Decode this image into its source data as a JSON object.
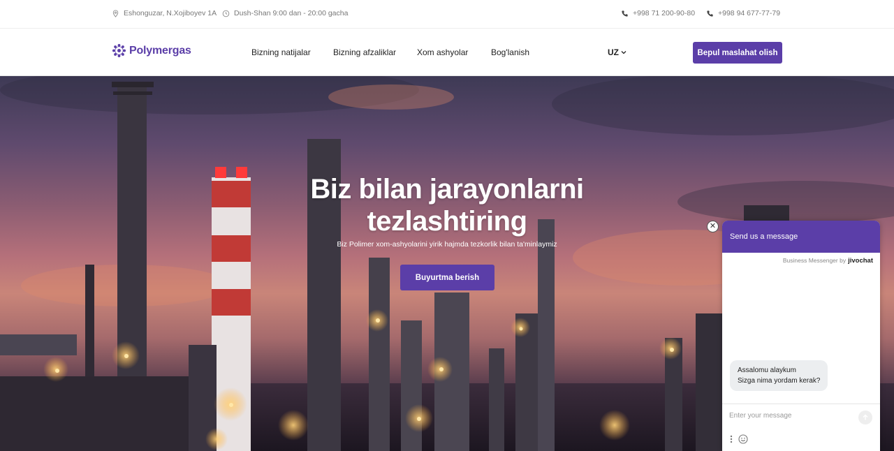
{
  "topbar": {
    "address": "Eshonguzar, N.Xojiboyev 1A",
    "hours": "Dush-Shan 9:00 dan - 20:00 gacha",
    "phone1": "+998 71 200-90-80",
    "phone2": "+998 94 677-77-79"
  },
  "nav": {
    "logo": "Polymergas",
    "links": [
      "Bizning natijalar",
      "Bizning afzaliklar",
      "Xom ashyolar",
      "Bog'lanish"
    ],
    "language": "UZ",
    "cta": "Bepul maslahat olish"
  },
  "hero": {
    "title_line1": "Biz bilan jarayonlarni",
    "title_line2": "tezlashtiring",
    "subtitle": "Biz Polimer xom-ashyolarini yirik hajmda tezkorlik bilan ta'minlaymiz",
    "button": "Buyurtma berish"
  },
  "chat": {
    "header": "Send us a message",
    "brand_prefix": "Business Messenger by",
    "brand_name": "jivochat",
    "greeting_line1": "Assalomu alaykum",
    "greeting_line2": "Sizga nima yordam kerak?",
    "input_placeholder": "Enter your message"
  },
  "colors": {
    "accent": "#5b3ea8"
  }
}
